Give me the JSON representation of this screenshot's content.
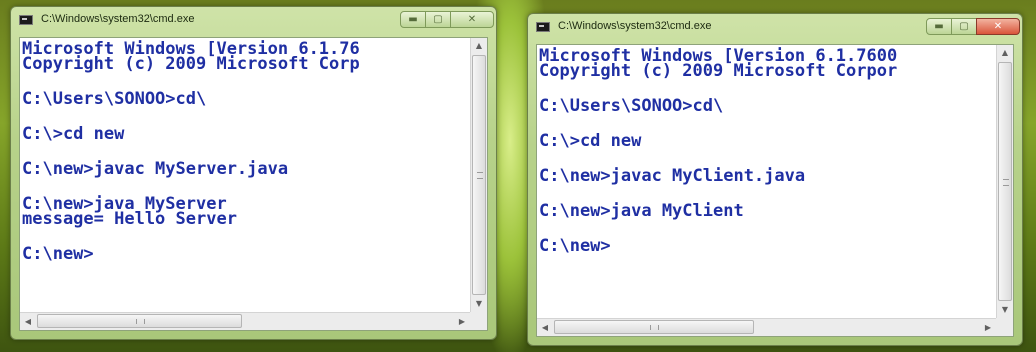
{
  "windows": [
    {
      "title": "C:\\Windows\\system32\\cmd.exe",
      "lines": [
        "Microsoft Windows [Version 6.1.76",
        "Copyright (c) 2009 Microsoft Corp",
        "",
        "C:\\Users\\SONOO>cd\\",
        "",
        "C:\\>cd new",
        "",
        "C:\\new>javac MyServer.java",
        "",
        "C:\\new>java MyServer",
        "message= Hello Server",
        "",
        "C:\\new>"
      ]
    },
    {
      "title": "C:\\Windows\\system32\\cmd.exe",
      "lines": [
        "Microsoft Windows [Version 6.1.7600",
        "Copyright (c) 2009 Microsoft Corpor",
        "",
        "C:\\Users\\SONOO>cd\\",
        "",
        "C:\\>cd new",
        "",
        "C:\\new>javac MyClient.java",
        "",
        "C:\\new>java MyClient",
        "",
        "C:\\new>"
      ]
    }
  ],
  "icons": {
    "app": "cmd-app-icon",
    "minimize": "minimize-icon",
    "maximize": "maximize-icon",
    "close": "close-icon"
  }
}
